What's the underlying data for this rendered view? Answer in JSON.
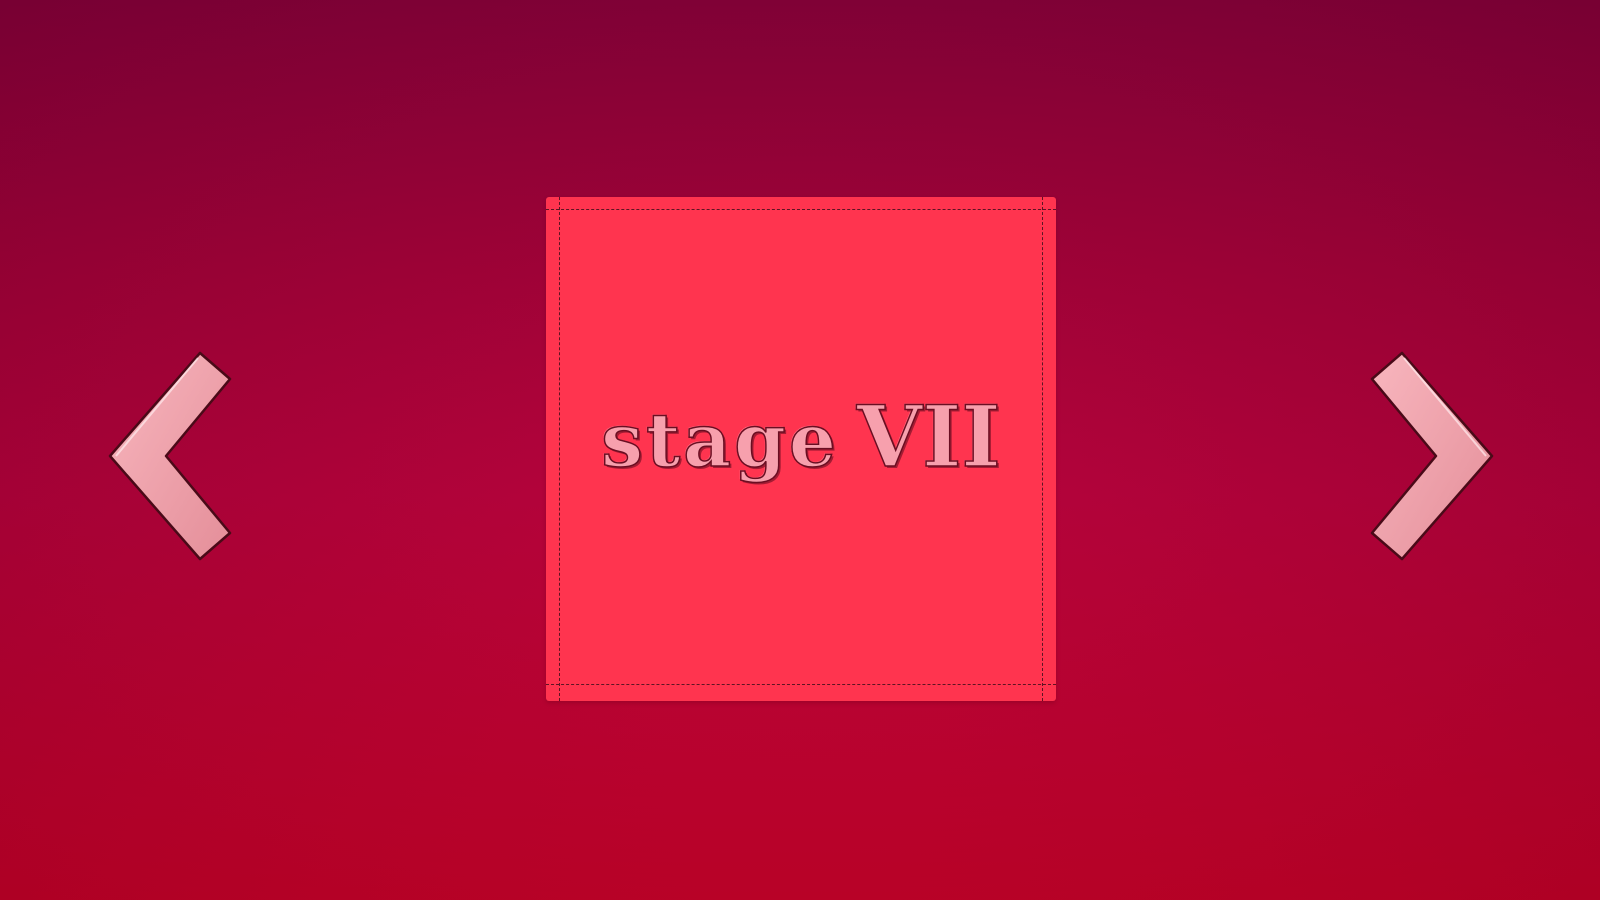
{
  "stage_select": {
    "title_word": "stage",
    "stage_numeral": "VII",
    "prev_icon": "chevron-left-icon",
    "next_icon": "chevron-right-icon"
  },
  "colors": {
    "background_top": "#88003a",
    "background_bottom": "#c30028",
    "card_fill": "#ff344f",
    "arrow_fill": "#f3a1ab",
    "title_fill": "#f7a0ad"
  }
}
